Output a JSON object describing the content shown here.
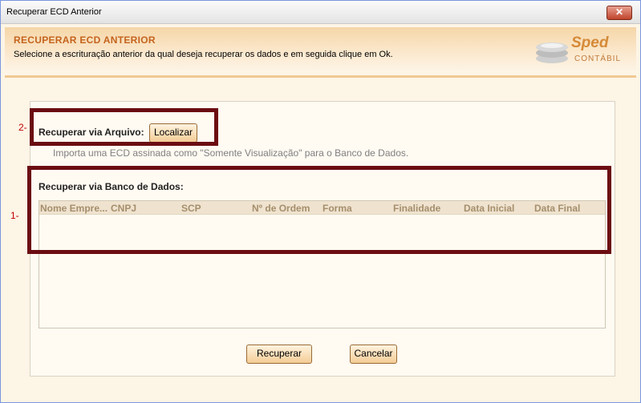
{
  "window": {
    "title": "Recuperar ECD Anterior",
    "close_glyph": "✕"
  },
  "header": {
    "title": "RECUPERAR ECD ANTERIOR",
    "subtitle": "Selecione a escrituração anterior da qual deseja recuperar os dados e em seguida clique em Ok."
  },
  "logo": {
    "name": "Sped",
    "sub": "CONTÁBIL"
  },
  "arquivo": {
    "label": "Recuperar via Arquivo:",
    "button": "Localizar",
    "hint": "Importa uma ECD assinada como \"Somente Visualização\" para o Banco de Dados."
  },
  "banco": {
    "label": "Recuperar via Banco de Dados:",
    "columns": [
      "Nome Empre...",
      "CNPJ",
      "SCP",
      "Nº de Ordem",
      "Forma",
      "Finalidade",
      "Data Inicial",
      "Data Final"
    ]
  },
  "buttons": {
    "recuperar": "Recuperar",
    "cancelar": "Cancelar"
  },
  "annotations": {
    "a1": "1-",
    "a2": "2-"
  },
  "colors": {
    "accent": "#c4631d",
    "highlight_box": "#6b0d12",
    "annotation": "#c00000"
  }
}
